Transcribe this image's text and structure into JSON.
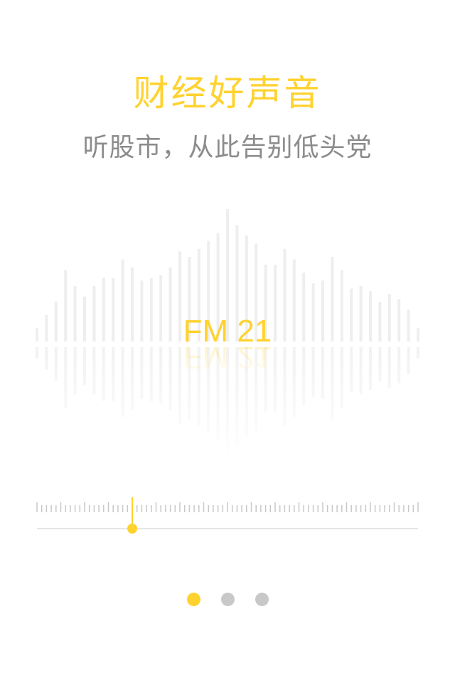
{
  "onboarding": {
    "title": "财经好声音",
    "subtitle": "听股市，从此告别低头党",
    "station": "FM 21"
  },
  "waveform": {
    "bar_color": "#eeeeee",
    "levels": [
      0.1,
      0.2,
      0.3,
      0.54,
      0.42,
      0.34,
      0.42,
      0.48,
      0.48,
      0.62,
      0.56,
      0.46,
      0.48,
      0.5,
      0.56,
      0.68,
      0.64,
      0.7,
      0.76,
      0.82,
      1.0,
      0.88,
      0.8,
      0.74,
      0.58,
      0.58,
      0.7,
      0.62,
      0.52,
      0.44,
      0.46,
      0.64,
      0.54,
      0.4,
      0.42,
      0.38,
      0.3,
      0.36,
      0.32,
      0.24,
      0.1
    ]
  },
  "tuner": {
    "accent": "#ffd22e",
    "tick_color": "#c8c8c8",
    "position": 0.25
  },
  "pager": {
    "pages": 3,
    "active": 0,
    "active_color": "#ffd22e",
    "inactive_color": "#c8c8c8"
  }
}
